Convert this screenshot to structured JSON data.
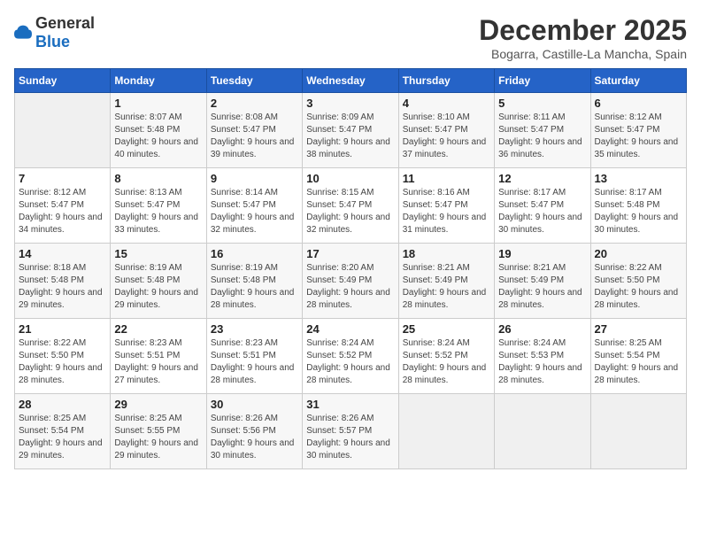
{
  "logo": {
    "general": "General",
    "blue": "Blue"
  },
  "header": {
    "month": "December 2025",
    "location": "Bogarra, Castille-La Mancha, Spain"
  },
  "weekdays": [
    "Sunday",
    "Monday",
    "Tuesday",
    "Wednesday",
    "Thursday",
    "Friday",
    "Saturday"
  ],
  "weeks": [
    [
      {
        "day": "",
        "sunrise": "",
        "sunset": "",
        "daylight": ""
      },
      {
        "day": "1",
        "sunrise": "Sunrise: 8:07 AM",
        "sunset": "Sunset: 5:48 PM",
        "daylight": "Daylight: 9 hours and 40 minutes."
      },
      {
        "day": "2",
        "sunrise": "Sunrise: 8:08 AM",
        "sunset": "Sunset: 5:47 PM",
        "daylight": "Daylight: 9 hours and 39 minutes."
      },
      {
        "day": "3",
        "sunrise": "Sunrise: 8:09 AM",
        "sunset": "Sunset: 5:47 PM",
        "daylight": "Daylight: 9 hours and 38 minutes."
      },
      {
        "day": "4",
        "sunrise": "Sunrise: 8:10 AM",
        "sunset": "Sunset: 5:47 PM",
        "daylight": "Daylight: 9 hours and 37 minutes."
      },
      {
        "day": "5",
        "sunrise": "Sunrise: 8:11 AM",
        "sunset": "Sunset: 5:47 PM",
        "daylight": "Daylight: 9 hours and 36 minutes."
      },
      {
        "day": "6",
        "sunrise": "Sunrise: 8:12 AM",
        "sunset": "Sunset: 5:47 PM",
        "daylight": "Daylight: 9 hours and 35 minutes."
      }
    ],
    [
      {
        "day": "7",
        "sunrise": "Sunrise: 8:12 AM",
        "sunset": "Sunset: 5:47 PM",
        "daylight": "Daylight: 9 hours and 34 minutes."
      },
      {
        "day": "8",
        "sunrise": "Sunrise: 8:13 AM",
        "sunset": "Sunset: 5:47 PM",
        "daylight": "Daylight: 9 hours and 33 minutes."
      },
      {
        "day": "9",
        "sunrise": "Sunrise: 8:14 AM",
        "sunset": "Sunset: 5:47 PM",
        "daylight": "Daylight: 9 hours and 32 minutes."
      },
      {
        "day": "10",
        "sunrise": "Sunrise: 8:15 AM",
        "sunset": "Sunset: 5:47 PM",
        "daylight": "Daylight: 9 hours and 32 minutes."
      },
      {
        "day": "11",
        "sunrise": "Sunrise: 8:16 AM",
        "sunset": "Sunset: 5:47 PM",
        "daylight": "Daylight: 9 hours and 31 minutes."
      },
      {
        "day": "12",
        "sunrise": "Sunrise: 8:17 AM",
        "sunset": "Sunset: 5:47 PM",
        "daylight": "Daylight: 9 hours and 30 minutes."
      },
      {
        "day": "13",
        "sunrise": "Sunrise: 8:17 AM",
        "sunset": "Sunset: 5:48 PM",
        "daylight": "Daylight: 9 hours and 30 minutes."
      }
    ],
    [
      {
        "day": "14",
        "sunrise": "Sunrise: 8:18 AM",
        "sunset": "Sunset: 5:48 PM",
        "daylight": "Daylight: 9 hours and 29 minutes."
      },
      {
        "day": "15",
        "sunrise": "Sunrise: 8:19 AM",
        "sunset": "Sunset: 5:48 PM",
        "daylight": "Daylight: 9 hours and 29 minutes."
      },
      {
        "day": "16",
        "sunrise": "Sunrise: 8:19 AM",
        "sunset": "Sunset: 5:48 PM",
        "daylight": "Daylight: 9 hours and 28 minutes."
      },
      {
        "day": "17",
        "sunrise": "Sunrise: 8:20 AM",
        "sunset": "Sunset: 5:49 PM",
        "daylight": "Daylight: 9 hours and 28 minutes."
      },
      {
        "day": "18",
        "sunrise": "Sunrise: 8:21 AM",
        "sunset": "Sunset: 5:49 PM",
        "daylight": "Daylight: 9 hours and 28 minutes."
      },
      {
        "day": "19",
        "sunrise": "Sunrise: 8:21 AM",
        "sunset": "Sunset: 5:49 PM",
        "daylight": "Daylight: 9 hours and 28 minutes."
      },
      {
        "day": "20",
        "sunrise": "Sunrise: 8:22 AM",
        "sunset": "Sunset: 5:50 PM",
        "daylight": "Daylight: 9 hours and 28 minutes."
      }
    ],
    [
      {
        "day": "21",
        "sunrise": "Sunrise: 8:22 AM",
        "sunset": "Sunset: 5:50 PM",
        "daylight": "Daylight: 9 hours and 28 minutes."
      },
      {
        "day": "22",
        "sunrise": "Sunrise: 8:23 AM",
        "sunset": "Sunset: 5:51 PM",
        "daylight": "Daylight: 9 hours and 27 minutes."
      },
      {
        "day": "23",
        "sunrise": "Sunrise: 8:23 AM",
        "sunset": "Sunset: 5:51 PM",
        "daylight": "Daylight: 9 hours and 28 minutes."
      },
      {
        "day": "24",
        "sunrise": "Sunrise: 8:24 AM",
        "sunset": "Sunset: 5:52 PM",
        "daylight": "Daylight: 9 hours and 28 minutes."
      },
      {
        "day": "25",
        "sunrise": "Sunrise: 8:24 AM",
        "sunset": "Sunset: 5:52 PM",
        "daylight": "Daylight: 9 hours and 28 minutes."
      },
      {
        "day": "26",
        "sunrise": "Sunrise: 8:24 AM",
        "sunset": "Sunset: 5:53 PM",
        "daylight": "Daylight: 9 hours and 28 minutes."
      },
      {
        "day": "27",
        "sunrise": "Sunrise: 8:25 AM",
        "sunset": "Sunset: 5:54 PM",
        "daylight": "Daylight: 9 hours and 28 minutes."
      }
    ],
    [
      {
        "day": "28",
        "sunrise": "Sunrise: 8:25 AM",
        "sunset": "Sunset: 5:54 PM",
        "daylight": "Daylight: 9 hours and 29 minutes."
      },
      {
        "day": "29",
        "sunrise": "Sunrise: 8:25 AM",
        "sunset": "Sunset: 5:55 PM",
        "daylight": "Daylight: 9 hours and 29 minutes."
      },
      {
        "day": "30",
        "sunrise": "Sunrise: 8:26 AM",
        "sunset": "Sunset: 5:56 PM",
        "daylight": "Daylight: 9 hours and 30 minutes."
      },
      {
        "day": "31",
        "sunrise": "Sunrise: 8:26 AM",
        "sunset": "Sunset: 5:57 PM",
        "daylight": "Daylight: 9 hours and 30 minutes."
      },
      {
        "day": "",
        "sunrise": "",
        "sunset": "",
        "daylight": ""
      },
      {
        "day": "",
        "sunrise": "",
        "sunset": "",
        "daylight": ""
      },
      {
        "day": "",
        "sunrise": "",
        "sunset": "",
        "daylight": ""
      }
    ]
  ]
}
